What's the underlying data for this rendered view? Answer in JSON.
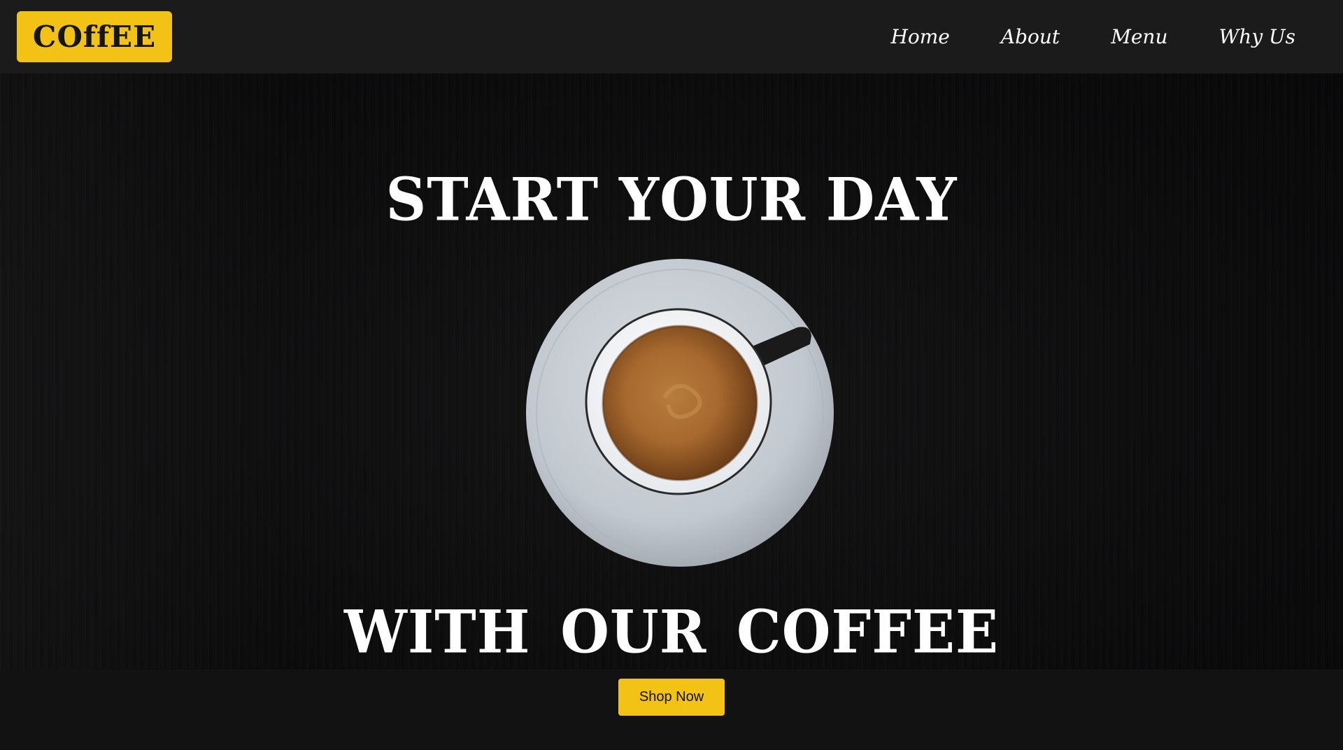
{
  "header": {
    "logo_text": "COffEE",
    "nav": [
      {
        "label": "Home"
      },
      {
        "label": "About"
      },
      {
        "label": "Menu"
      },
      {
        "label": "Why Us"
      }
    ]
  },
  "hero": {
    "headline_top": "START YOUR DAY",
    "headline_bottom": "WITH OUR COFFEE",
    "image": "coffee-cup-on-saucer-top-view",
    "cta_label": "Shop Now"
  },
  "colors": {
    "accent": "#f2c315",
    "header_bg": "#1b1b1c",
    "hero_bg": "#0d0d0d",
    "text": "#ffffff"
  }
}
